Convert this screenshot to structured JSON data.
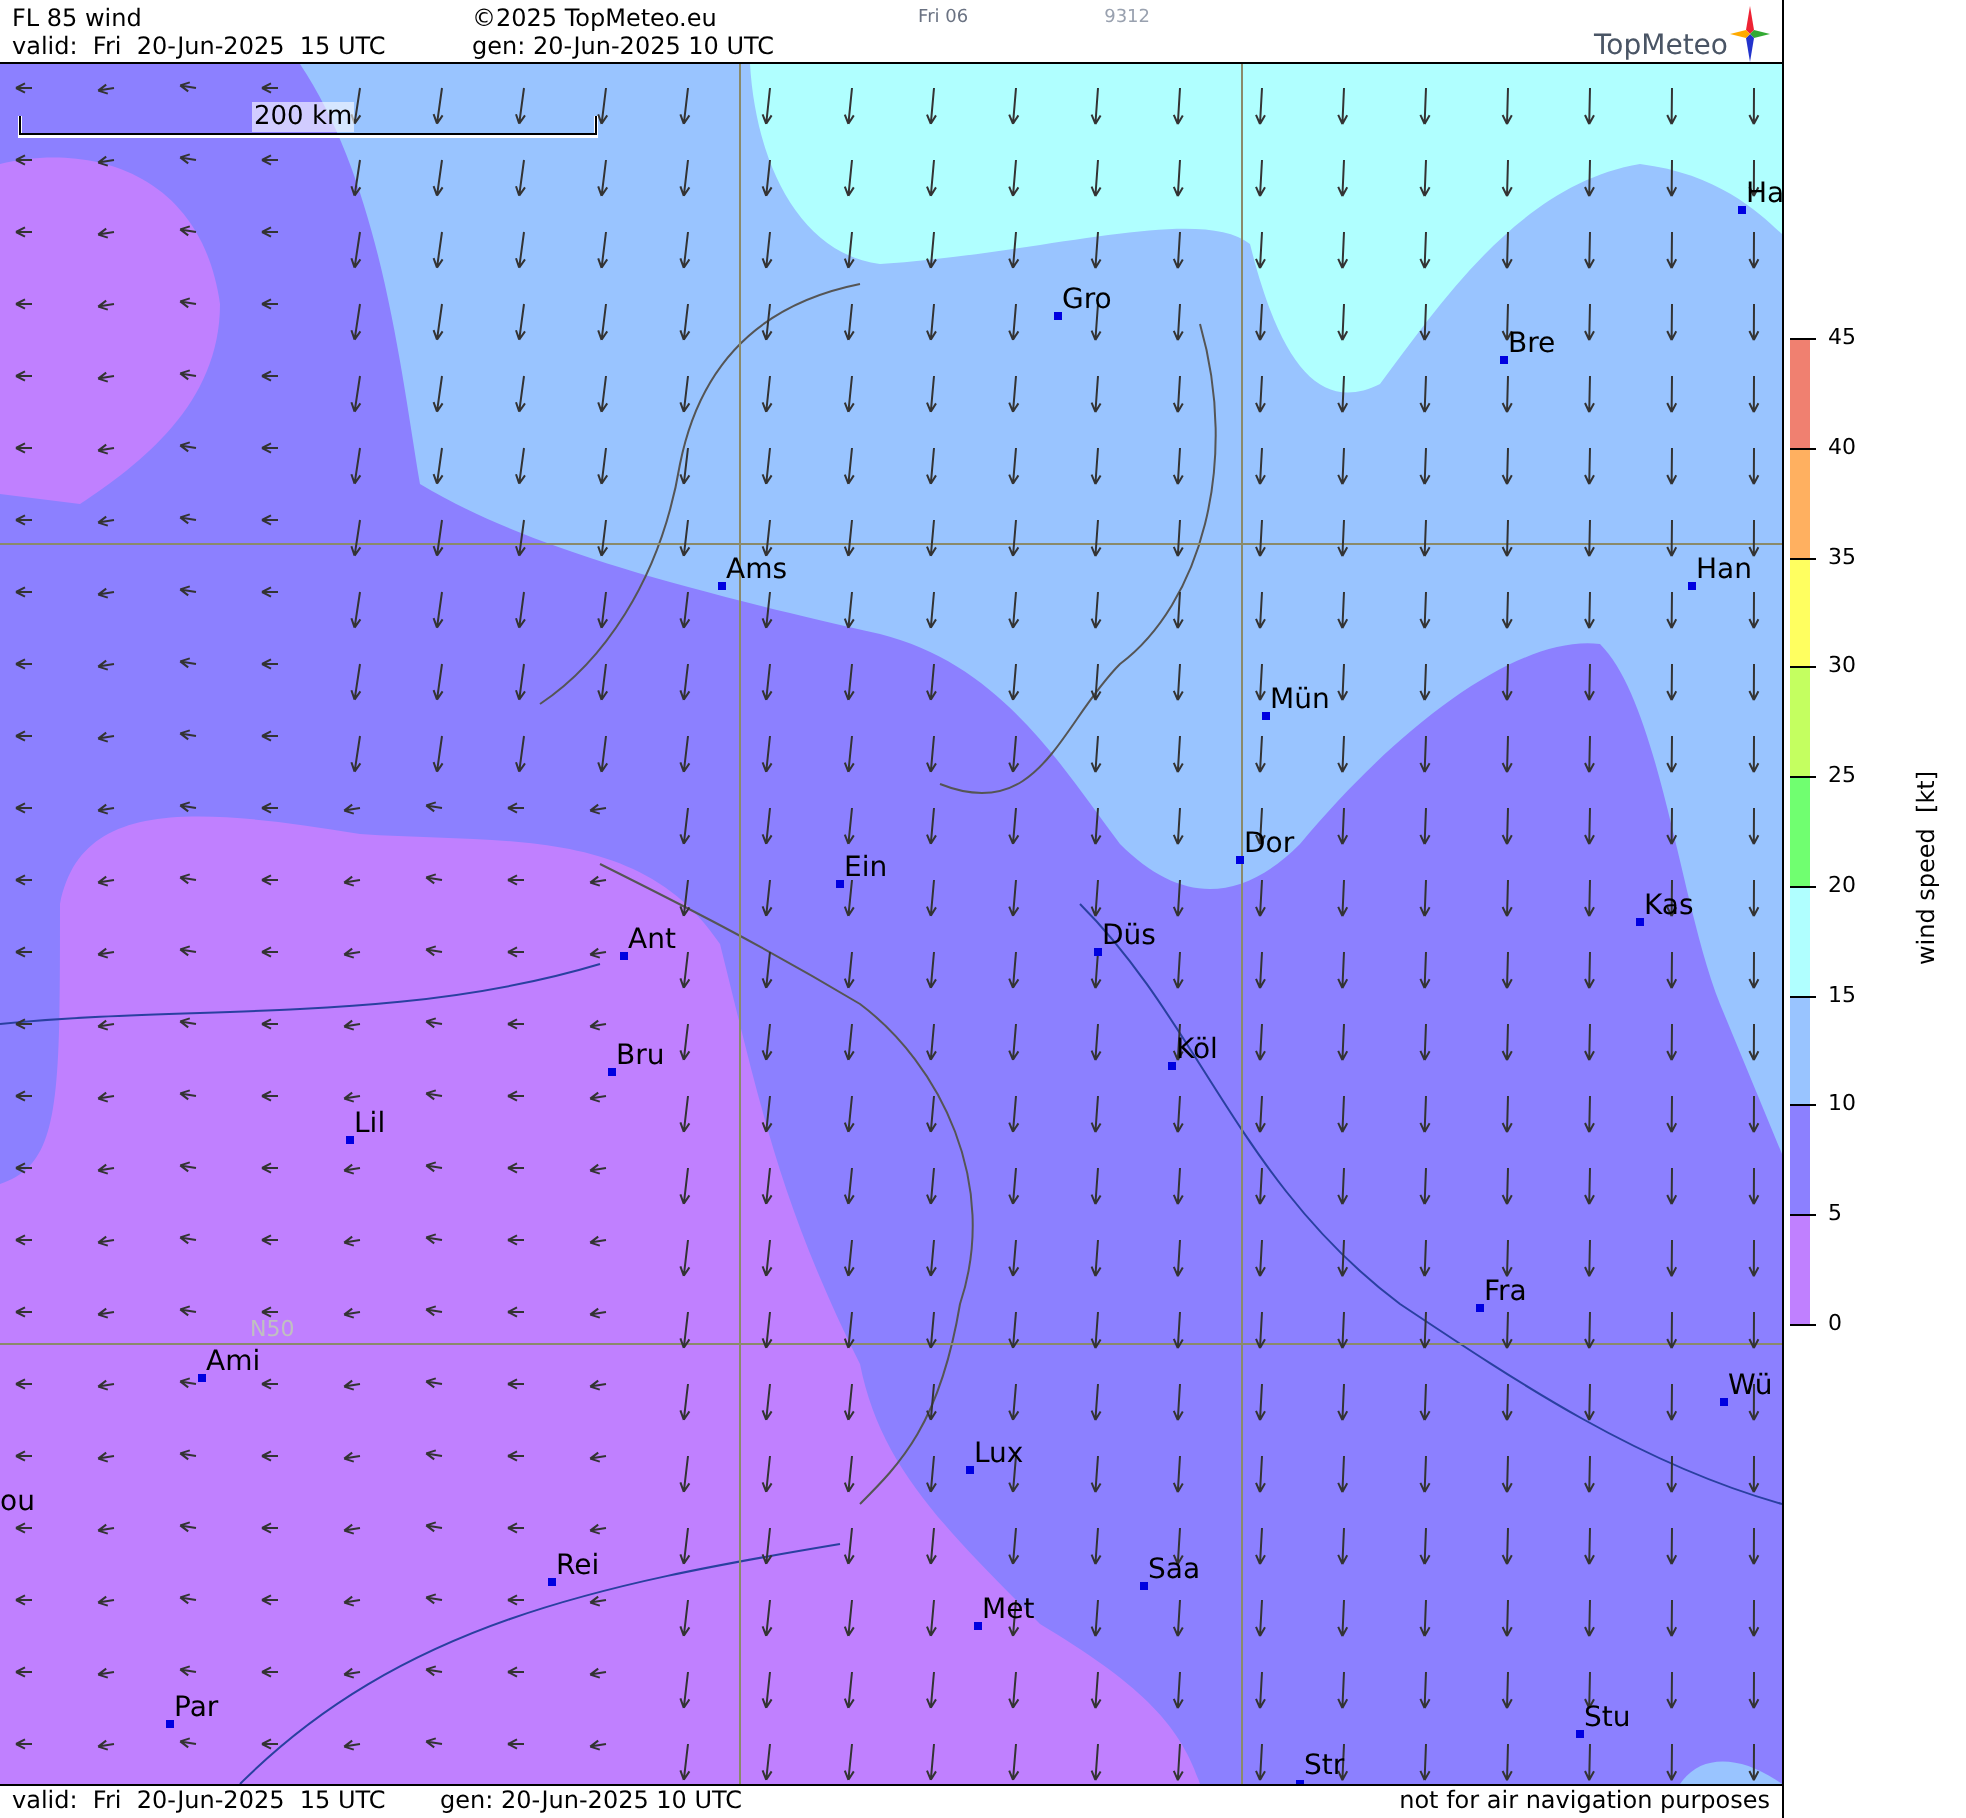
{
  "header": {
    "title": "FL 85 wind",
    "copyright": "©2025 TopMeteo.eu",
    "run_label": "Fri 06",
    "code": "9312",
    "valid": "valid:  Fri  20-Jun-2025  15 UTC",
    "generated": "gen: 20-Jun-2025 10 UTC",
    "logo": "TopMeteo"
  },
  "map": {
    "scale_bar": "200 km",
    "gridline_label": "N50",
    "cities": [
      {
        "label": "Ha"
      },
      {
        "label": "Gro"
      },
      {
        "label": "Bre"
      },
      {
        "label": "Ams"
      },
      {
        "label": "Han"
      },
      {
        "label": "Mün"
      },
      {
        "label": "Dor"
      },
      {
        "label": "Ein"
      },
      {
        "label": "Kas"
      },
      {
        "label": "Düs"
      },
      {
        "label": "Ant"
      },
      {
        "label": "Bru"
      },
      {
        "label": "Köl"
      },
      {
        "label": "Lil"
      },
      {
        "label": "Fra"
      },
      {
        "label": "Ami"
      },
      {
        "label": "Wü"
      },
      {
        "label": "Lux"
      },
      {
        "label": "ou"
      },
      {
        "label": "Rei"
      },
      {
        "label": "Saa"
      },
      {
        "label": "Met"
      },
      {
        "label": "Par"
      },
      {
        "label": "Stu"
      },
      {
        "label": "Str"
      }
    ]
  },
  "legend": {
    "title": "wind speed  [kt]",
    "ticks": [
      "45",
      "40",
      "35",
      "30",
      "25",
      "20",
      "15",
      "10",
      "5",
      "0"
    ],
    "bands": [
      {
        "color": "#f08070"
      },
      {
        "color": "#ffb060"
      },
      {
        "color": "#ffff60"
      },
      {
        "color": "#c4ff60"
      },
      {
        "color": "#70ff70"
      },
      {
        "color": "#b0ffff"
      },
      {
        "color": "#99c4ff"
      },
      {
        "color": "#8c80ff"
      },
      {
        "color": "#c080ff"
      }
    ]
  },
  "footer": {
    "valid": "valid:  Fri  20-Jun-2025  15 UTC",
    "generated": "gen: 20-Jun-2025 10 UTC",
    "disclaimer": "not for air navigation purposes"
  }
}
